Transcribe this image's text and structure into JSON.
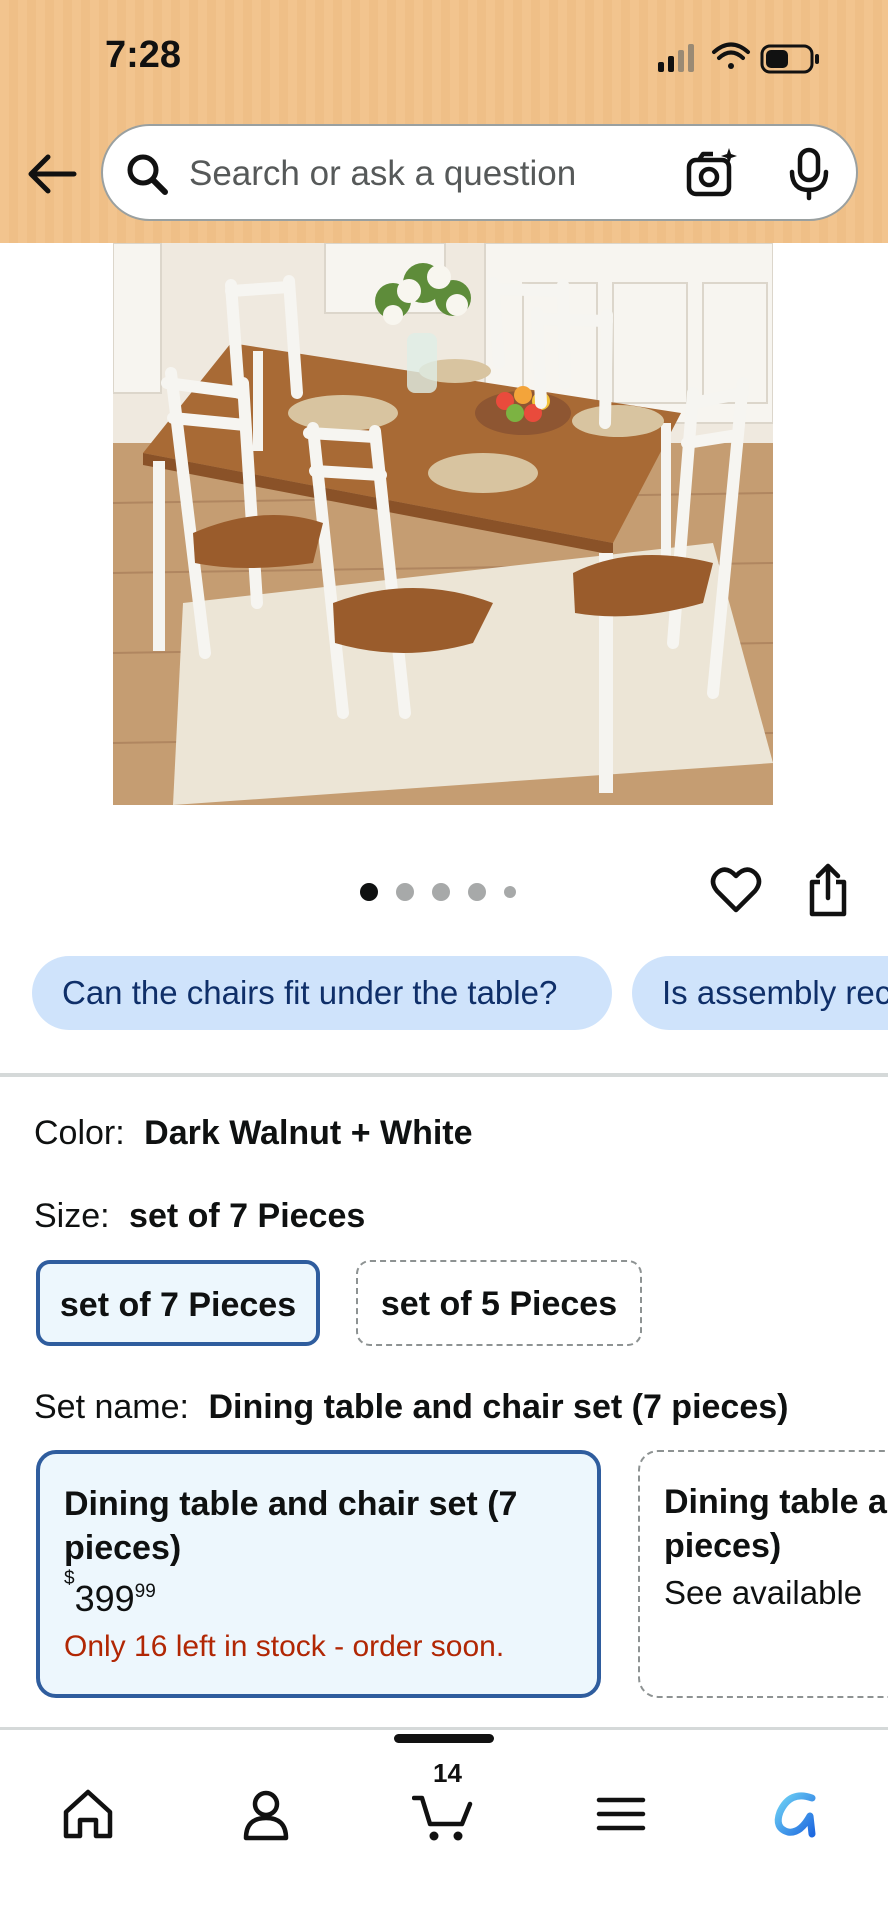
{
  "status_bar": {
    "time": "7:28"
  },
  "search": {
    "placeholder": "Search or ask a question"
  },
  "carousel": {
    "total_images": 5,
    "active_index": 0
  },
  "questions": [
    "Can the chairs fit under the table?",
    "Is assembly rec"
  ],
  "variations": {
    "color": {
      "label": "Color:",
      "value": "Dark Walnut + White"
    },
    "size": {
      "label": "Size:",
      "value": "set of 7 Pieces",
      "options": [
        "set of 7 Pieces",
        "set of 5 Pieces"
      ]
    },
    "set_name": {
      "label": "Set name:",
      "value": "Dining table and chair set (7 pieces)",
      "cards": [
        {
          "title": "Dining table and chair set (7 pieces)",
          "price_symbol": "$",
          "price_whole": "399",
          "price_cents": "99",
          "stock": "Only 16 left in stock - order soon."
        },
        {
          "title_line1": "Dining table a",
          "title_line2": "pieces)",
          "availability": "See available"
        }
      ]
    }
  },
  "bottom_nav": {
    "cart_count": "14"
  },
  "colors": {
    "header": "#f2c48e",
    "chip_bg": "#cfe3fb",
    "selected_border": "#2f5d9e",
    "stock_red": "#b12704"
  }
}
